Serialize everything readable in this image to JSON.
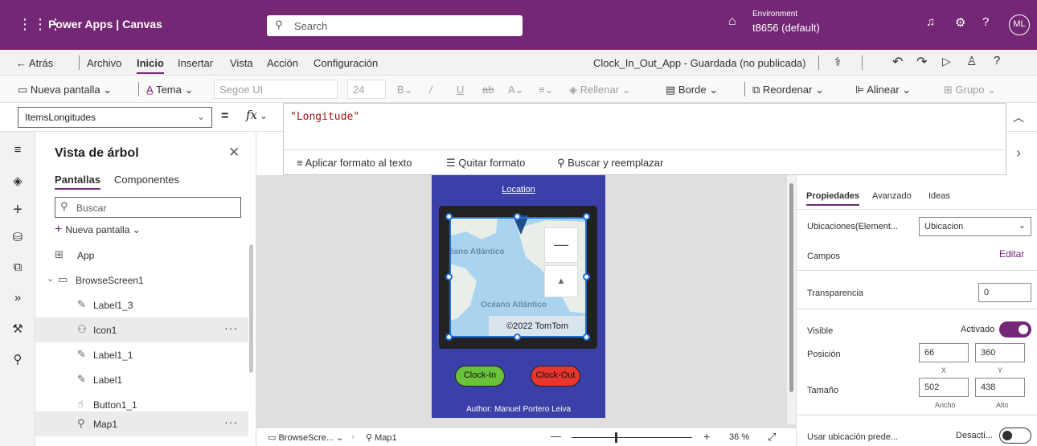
{
  "topbar": {
    "app_title": "Power Apps  |  Canvas",
    "search_placeholder": "Search",
    "environment_label": "Environment",
    "environment_value": "t8656 (default)",
    "avatar_initials": "ML"
  },
  "menu": {
    "back": "Atrás",
    "items": [
      "Archivo",
      "Inicio",
      "Insertar",
      "Vista",
      "Acción",
      "Configuración"
    ],
    "active": "Inicio",
    "app_status": "Clock_In_Out_App - Guardada (no publicada)"
  },
  "commandbar": {
    "new_screen": "Nueva pantalla",
    "theme": "Tema",
    "font": "Segoe UI",
    "font_size": "24",
    "fill": "Rellenar",
    "border": "Borde",
    "reorder": "Reordenar",
    "align": "Alinear",
    "group": "Grupo"
  },
  "formulabar": {
    "property": "ItemsLongitudes",
    "equals": "=",
    "fx": "fx",
    "formula": "\"Longitude\"",
    "format_text": "Aplicar formato al texto",
    "remove_format": "Quitar formato",
    "find_replace": "Buscar y reemplazar"
  },
  "tree": {
    "title": "Vista de árbol",
    "tabs": [
      "Pantallas",
      "Componentes"
    ],
    "search_placeholder": "Buscar",
    "new_screen": "Nueva pantalla",
    "nodes": [
      "App",
      "BrowseScreen1",
      "Label1_3",
      "Icon1",
      "Label1_1",
      "Label1",
      "Button1_1",
      "Map1"
    ]
  },
  "canvas": {
    "location_link": "Location",
    "ocean_top": "éano Atlántico",
    "ocean_bottom": "Océano Atlántico",
    "copyright": "©2022 TomTom",
    "clock_in": "Clock-In",
    "clock_out": "Clock-Out",
    "author": "Author: Manuel Portero Leiva"
  },
  "bottombar": {
    "screen": "BrowseScre...",
    "control": "Map1",
    "zoom": "36",
    "zoom_unit": "%",
    "zoom_level": 0.36
  },
  "properties": {
    "tabs": [
      "Propiedades",
      "Avanzado",
      "Ideas"
    ],
    "locations_label": "Ubicaciones(Element...",
    "locations_value": "Ubicacion",
    "fields_label": "Campos",
    "fields_action": "Editar",
    "transparency_label": "Transparencia",
    "transparency_value": "0",
    "visible_label": "Visible",
    "visible_value": "Activado",
    "position_label": "Posición",
    "position_x": "66",
    "position_y": "360",
    "x_label": "X",
    "y_label": "Y",
    "size_label": "Tamaño",
    "width": "502",
    "height": "438",
    "width_label": "Ancho",
    "height_label": "Alto",
    "default_location_label": "Usar ubicación prede...",
    "default_location_value": "Desacti..."
  },
  "colors": {
    "brand": "#742774",
    "screen_bg": "#3b40a8",
    "clock_in": "#6ac23a",
    "clock_out": "#e8362e"
  }
}
